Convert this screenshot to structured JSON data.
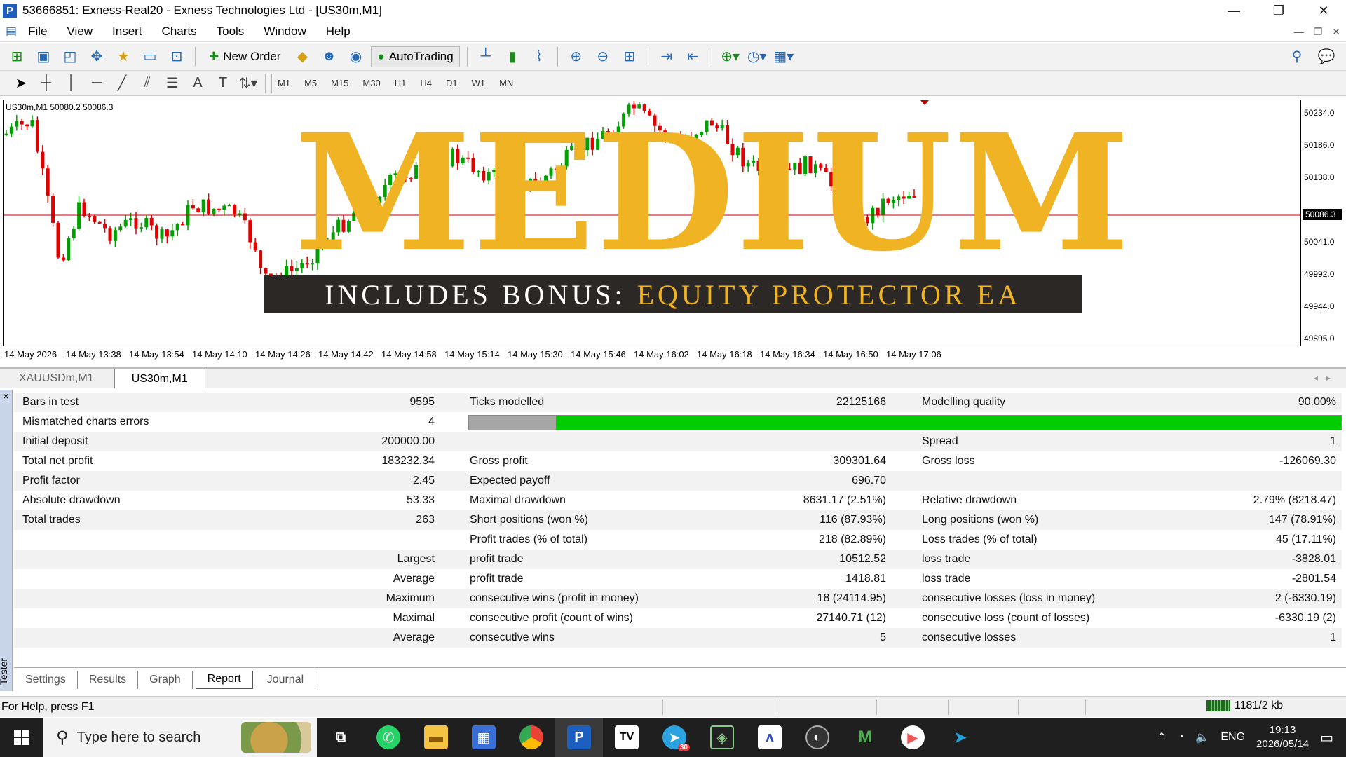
{
  "window": {
    "title": "53666851: Exness-Real20 - Exness Technologies Ltd - [US30m,M1]",
    "minimize": "—",
    "restore": "❐",
    "close": "✕"
  },
  "menu": [
    "File",
    "View",
    "Insert",
    "Charts",
    "Tools",
    "Window",
    "Help"
  ],
  "toolbar": {
    "new_order": "New Order",
    "autotrading": "AutoTrading",
    "timeframes": [
      "M1",
      "M5",
      "M15",
      "M30",
      "H1",
      "H4",
      "D1",
      "W1",
      "MN"
    ]
  },
  "chart": {
    "info": "US30m,M1  50080.2 50086.3",
    "price_labels": [
      "50234.0",
      "50186.0",
      "50138.0",
      "50086.3",
      "50041.0",
      "49992.0",
      "49944.0",
      "49895.0"
    ],
    "current_price": "50086.3",
    "time_labels": [
      "14 May 2026",
      "14 May 13:38",
      "14 May 13:54",
      "14 May 14:10",
      "14 May 14:26",
      "14 May 14:42",
      "14 May 14:58",
      "14 May 15:14",
      "14 May 15:30",
      "14 May 15:46",
      "14 May 16:02",
      "14 May 16:18",
      "14 May 16:34",
      "14 May 16:50",
      "14 May 17:06"
    ],
    "colors": {
      "up": "#00a000",
      "down": "#e00000",
      "price_line": "#c00000"
    }
  },
  "banner": {
    "title": "MEDIUM",
    "bonus_white": "INCLUDES BONUS:",
    "bonus_gold": "EQUITY PROTECTOR EA",
    "gold": "#f0b323"
  },
  "chart_tabs": [
    "XAUUSDm,M1",
    "US30m,M1"
  ],
  "report": {
    "rows": [
      {
        "c1": "Bars in test",
        "c2": "9595",
        "c3": "Ticks modelled",
        "c4": "22125166",
        "c5": "Modelling quality",
        "c6": "90.00%"
      },
      {
        "c1": "Mismatched charts errors",
        "c2": "4",
        "c3": "",
        "c4": "",
        "c5": "",
        "c6": "",
        "quality_bar": true
      },
      {
        "c1": "Initial deposit",
        "c2": "200000.00",
        "c3": "",
        "c4": "",
        "c5": "Spread",
        "c6": "1"
      },
      {
        "c1": "Total net profit",
        "c2": "183232.34",
        "c3": "Gross profit",
        "c4": "309301.64",
        "c5": "Gross loss",
        "c6": "-126069.30"
      },
      {
        "c1": "Profit factor",
        "c2": "2.45",
        "c3": "Expected payoff",
        "c4": "696.70",
        "c5": "",
        "c6": ""
      },
      {
        "c1": "Absolute drawdown",
        "c2": "53.33",
        "c3": "Maximal drawdown",
        "c4": "8631.17 (2.51%)",
        "c5": "Relative drawdown",
        "c6": "2.79% (8218.47)"
      },
      {
        "c1": "Total trades",
        "c2": "263",
        "c3": "Short positions (won %)",
        "c4": "116 (87.93%)",
        "c5": "Long positions (won %)",
        "c6": "147 (78.91%)"
      },
      {
        "c1": "",
        "c2": "",
        "c3": "Profit trades (% of total)",
        "c4": "218 (82.89%)",
        "c5": "Loss trades (% of total)",
        "c6": "45 (17.11%)"
      },
      {
        "c1": "",
        "c2": "Largest",
        "c3": "profit trade",
        "c4": "10512.52",
        "c5": "loss trade",
        "c6": "-3828.01"
      },
      {
        "c1": "",
        "c2": "Average",
        "c3": "profit trade",
        "c4": "1418.81",
        "c5": "loss trade",
        "c6": "-2801.54"
      },
      {
        "c1": "",
        "c2": "Maximum",
        "c3": "consecutive wins (profit in money)",
        "c4": "18 (24114.95)",
        "c5": "consecutive losses (loss in money)",
        "c6": "2 (-6330.19)"
      },
      {
        "c1": "",
        "c2": "Maximal",
        "c3": "consecutive profit (count of wins)",
        "c4": "27140.71 (12)",
        "c5": "consecutive loss (count of losses)",
        "c6": "-6330.19 (2)"
      },
      {
        "c1": "",
        "c2": "Average",
        "c3": "consecutive wins",
        "c4": "5",
        "c5": "consecutive losses",
        "c6": "1"
      }
    ],
    "modelling_quality": 0.9
  },
  "tester": {
    "label": "Tester",
    "close": "✕",
    "tabs": [
      "Settings",
      "Results",
      "Graph",
      "Report",
      "Journal"
    ],
    "active_tab": "Report"
  },
  "status": {
    "help": "For Help, press F1",
    "connection": "1181/2 kb"
  },
  "taskbar": {
    "search_placeholder": "Type here to search",
    "lang": "ENG",
    "time": "19:13",
    "date": "2026/05/14",
    "telegram_badge": "30"
  }
}
